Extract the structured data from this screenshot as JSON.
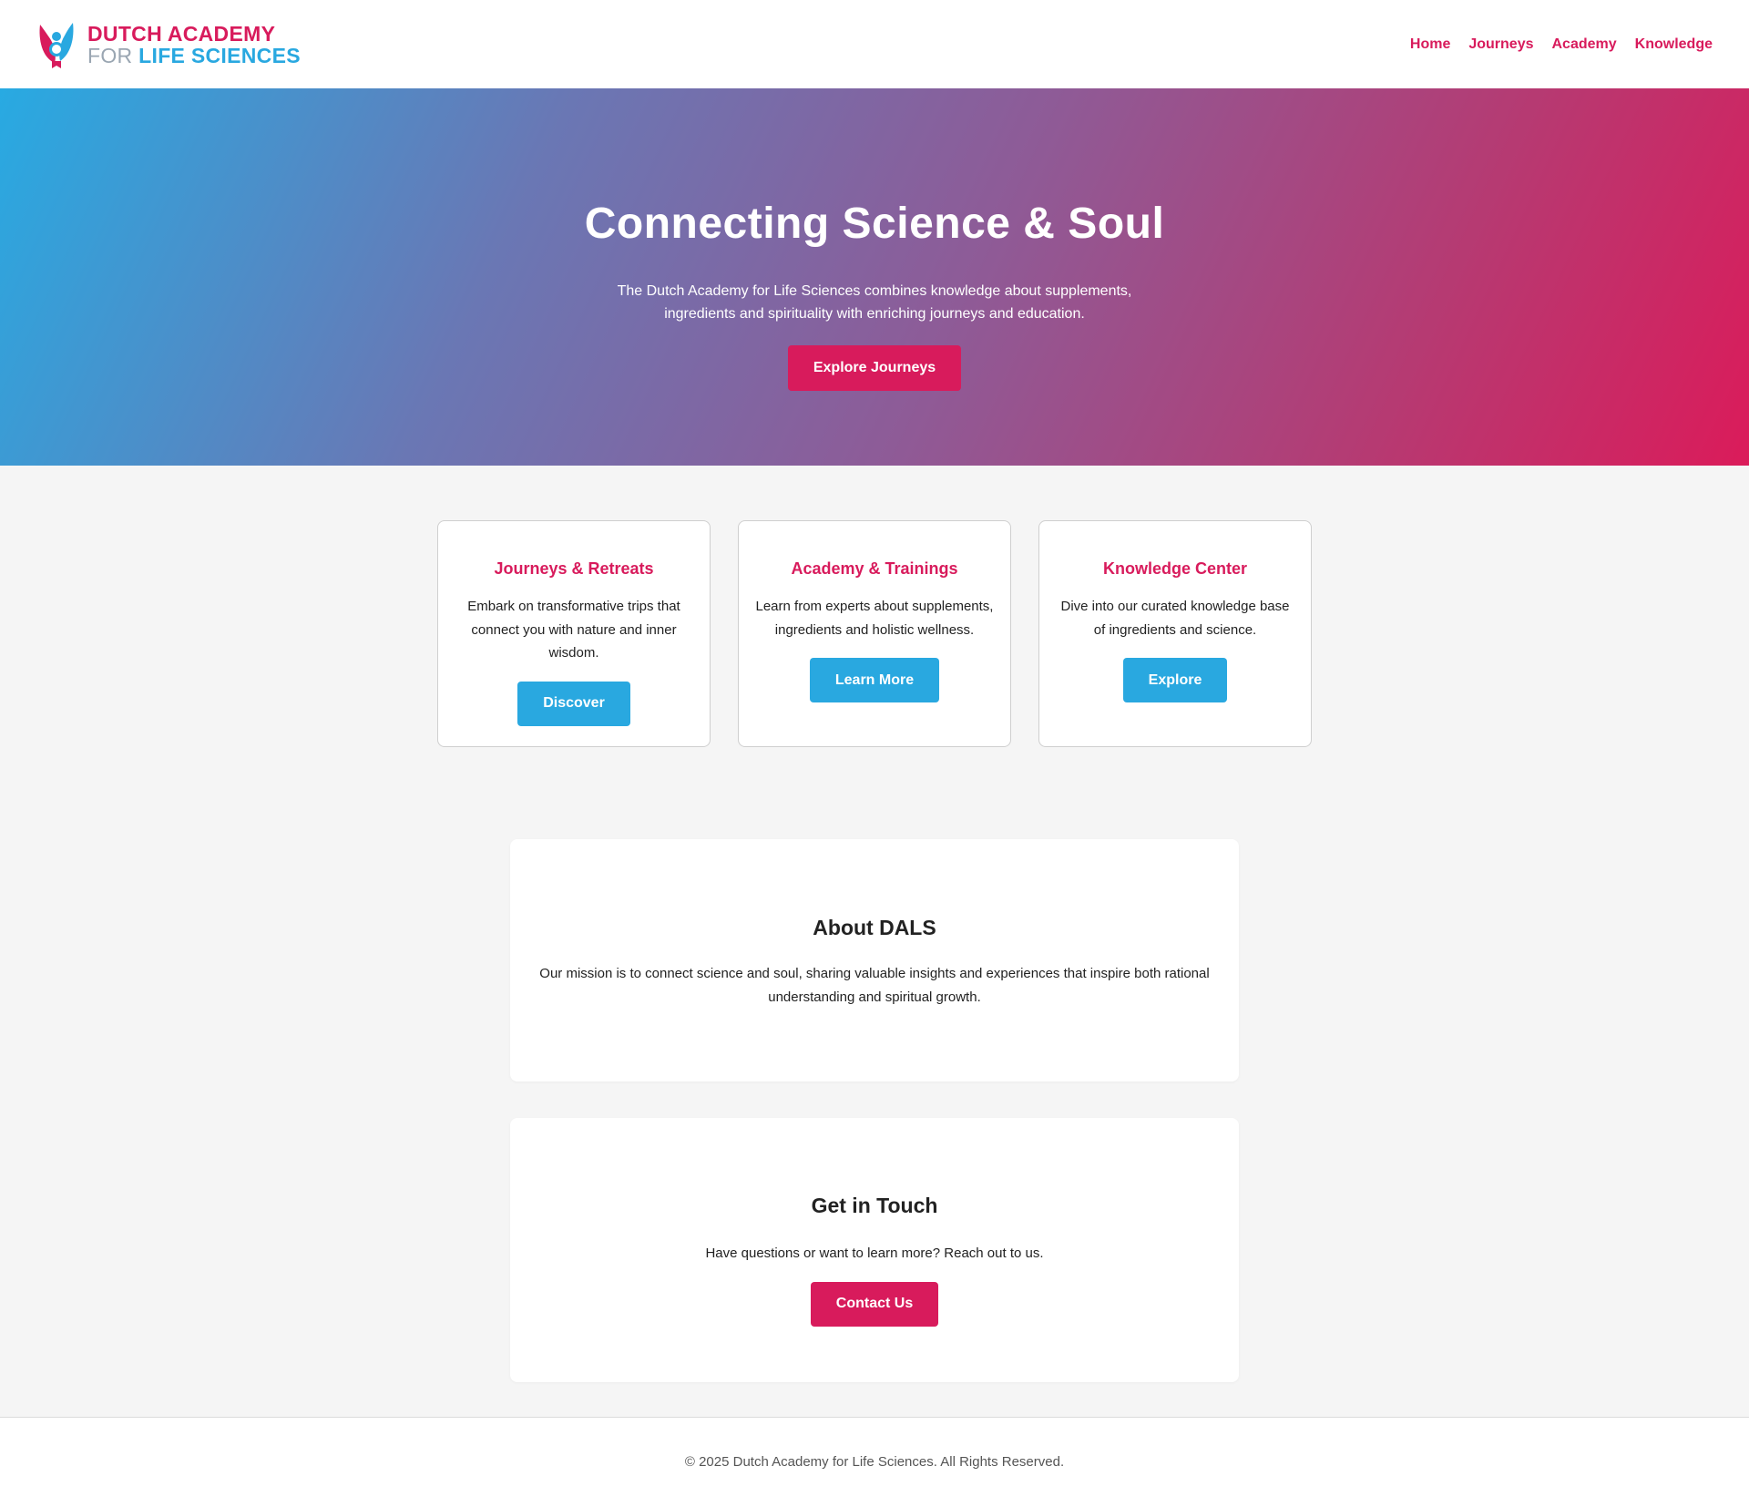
{
  "header": {
    "brand_line1": "DUTCH ACADEMY",
    "brand_for": "FOR",
    "brand_life_sciences": "LIFE SCIENCES",
    "nav": [
      "Home",
      "Journeys",
      "Academy",
      "Knowledge"
    ]
  },
  "hero": {
    "title": "Connecting Science & Soul",
    "text": "The Dutch Academy for Life Sciences combines knowledge about supplements, ingredients and spirituality with enriching journeys and education.",
    "button": "Explore Journeys"
  },
  "cards": [
    {
      "title": "Journeys & Retreats",
      "text": "Embark on transformative trips that connect you with nature and inner wisdom.",
      "button": "Discover"
    },
    {
      "title": "Academy & Trainings",
      "text": "Learn from experts about supplements, ingredients and holistic wellness.",
      "button": "Learn More"
    },
    {
      "title": "Knowledge Center",
      "text": "Dive into our curated knowledge base of ingredients and science.",
      "button": "Explore"
    }
  ],
  "about": {
    "title": "About DALS",
    "text": "Our mission is to connect science and soul, sharing valuable insights and experiences that inspire both rational understanding and spiritual growth."
  },
  "contact": {
    "title": "Get in Touch",
    "text": "Have questions or want to learn more? Reach out to us.",
    "button": "Contact Us"
  },
  "footer": {
    "copyright": "© 2025 Dutch Academy for Life Sciences. All Rights Reserved."
  },
  "colors": {
    "brand_pink": "#d81b5c",
    "brand_blue": "#29a8e0",
    "background": "#f5f5f5"
  },
  "icons": {
    "logo": "butterfly-person-logo-icon"
  }
}
